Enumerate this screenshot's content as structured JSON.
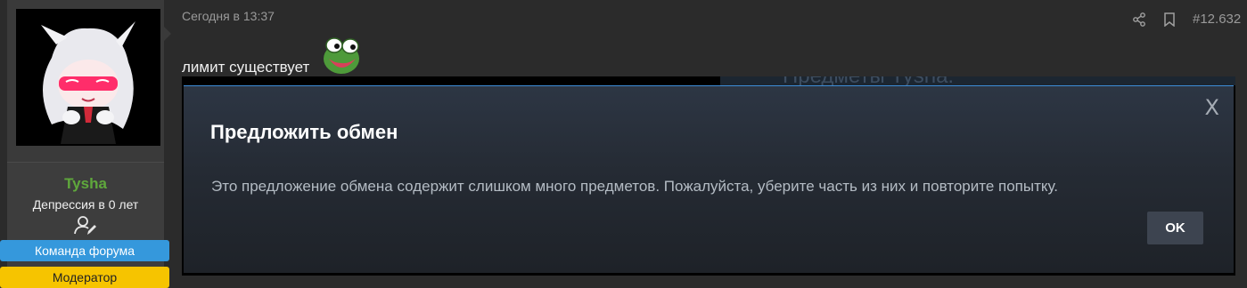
{
  "user": {
    "name": "Tysha",
    "title": "Депрессия в 0 лет",
    "banners": [
      "Команда форума",
      "Модератор"
    ]
  },
  "post": {
    "time": "Сегодня в 13:37",
    "number": "#12.632",
    "message": "лимит существует"
  },
  "screenshot": {
    "background_text": "Предметы Tysha:",
    "dialog": {
      "title": "Предложить обмен",
      "body": "Это предложение обмена содержит слишком много предметов. Пожалуйста, уберите часть из них и повторите попытку.",
      "ok_label": "OK",
      "close_label": "X"
    }
  },
  "colors": {
    "username": "#5fa83c",
    "banner_team": "#3598dc",
    "banner_mod": "#f6c400",
    "dialog_accent": "#3d8dd8"
  },
  "icons": {
    "share": "share-icon",
    "bookmark": "bookmark-icon",
    "user_edit": "user-edit-icon",
    "emoji": "pepe-emoji-icon"
  }
}
